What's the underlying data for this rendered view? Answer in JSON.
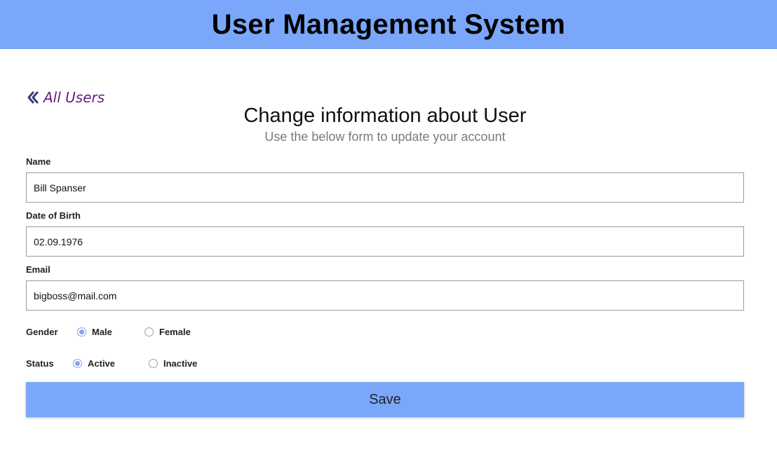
{
  "header": {
    "title": "User Management System",
    "background": "#7ba7fb"
  },
  "nav": {
    "back_label": "All Users",
    "back_icon": "double-chevron-left-icon",
    "link_color": "#6a1a85"
  },
  "form": {
    "title": "Change information about User",
    "subtitle": "Use the below form to update your account",
    "fields": [
      {
        "label": "Name",
        "value": "Bill Spanser"
      },
      {
        "label": "Date of Birth",
        "value": "02.09.1976"
      },
      {
        "label": "Email",
        "value": "bigboss@mail.com"
      }
    ],
    "gender": {
      "label": "Gender",
      "options": [
        "Male",
        "Female"
      ],
      "selected": "Male"
    },
    "status": {
      "label": "Status",
      "options": [
        "Active",
        "Inactive"
      ],
      "selected": "Active"
    },
    "save_label": "Save",
    "accent": "#7ba7fb"
  }
}
